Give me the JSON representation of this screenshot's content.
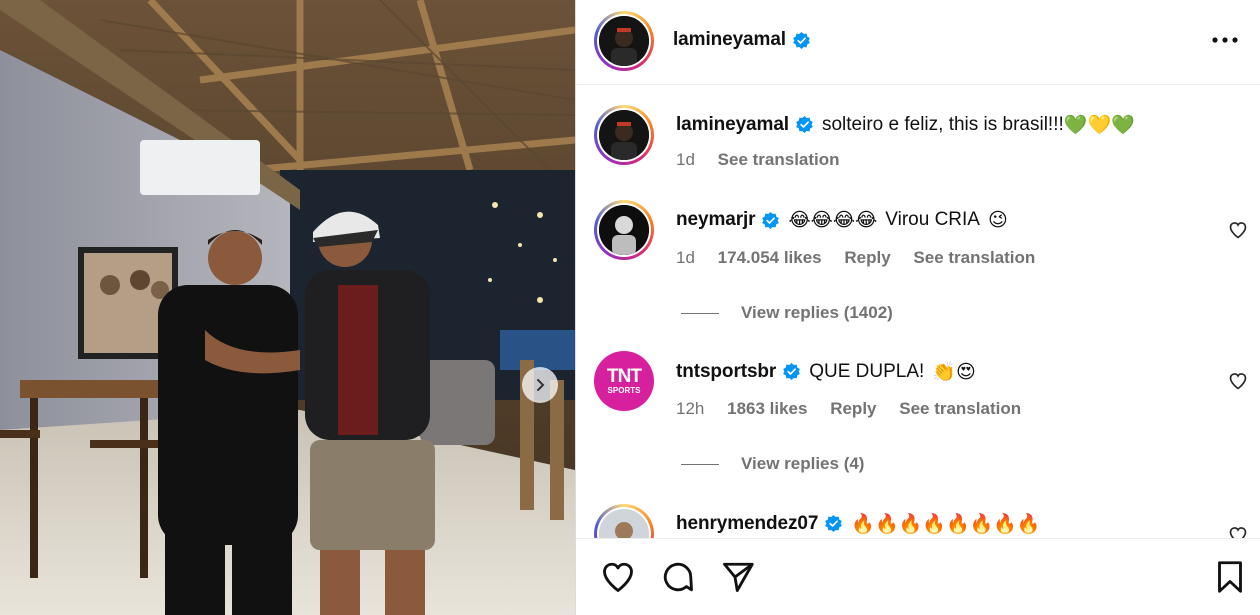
{
  "post": {
    "author": "lamineyamal",
    "more_icon": "more-horizontal-icon"
  },
  "caption": {
    "username": "lamineyamal",
    "text": "solteiro e feliz, this is brasil!!!",
    "emojis": "💚💛💚",
    "age": "1d",
    "translate": "See translation"
  },
  "comments": [
    {
      "username": "neymarjr",
      "emojis_pre": "😂😂😂😂",
      "text": "Virou CRIA",
      "emojis_post": "😉",
      "age": "1d",
      "likes": "174.054 likes",
      "reply": "Reply",
      "translate": "See translation",
      "view_replies": "View replies (1402)"
    },
    {
      "username": "tntsportsbr",
      "text": "QUE DUPLA!",
      "emojis_post": "👏😍",
      "age": "12h",
      "likes": "1863 likes",
      "reply": "Reply",
      "translate": "See translation",
      "view_replies": "View replies (4)",
      "avatar_text": "TNT",
      "avatar_sub": "SPORTS"
    },
    {
      "username": "henrymendez07",
      "emojis_post": "🔥🔥🔥🔥🔥🔥🔥🔥"
    }
  ],
  "colors": {
    "verified": "#0095f6",
    "tnt": "#d6209e",
    "meta": "#737373"
  }
}
